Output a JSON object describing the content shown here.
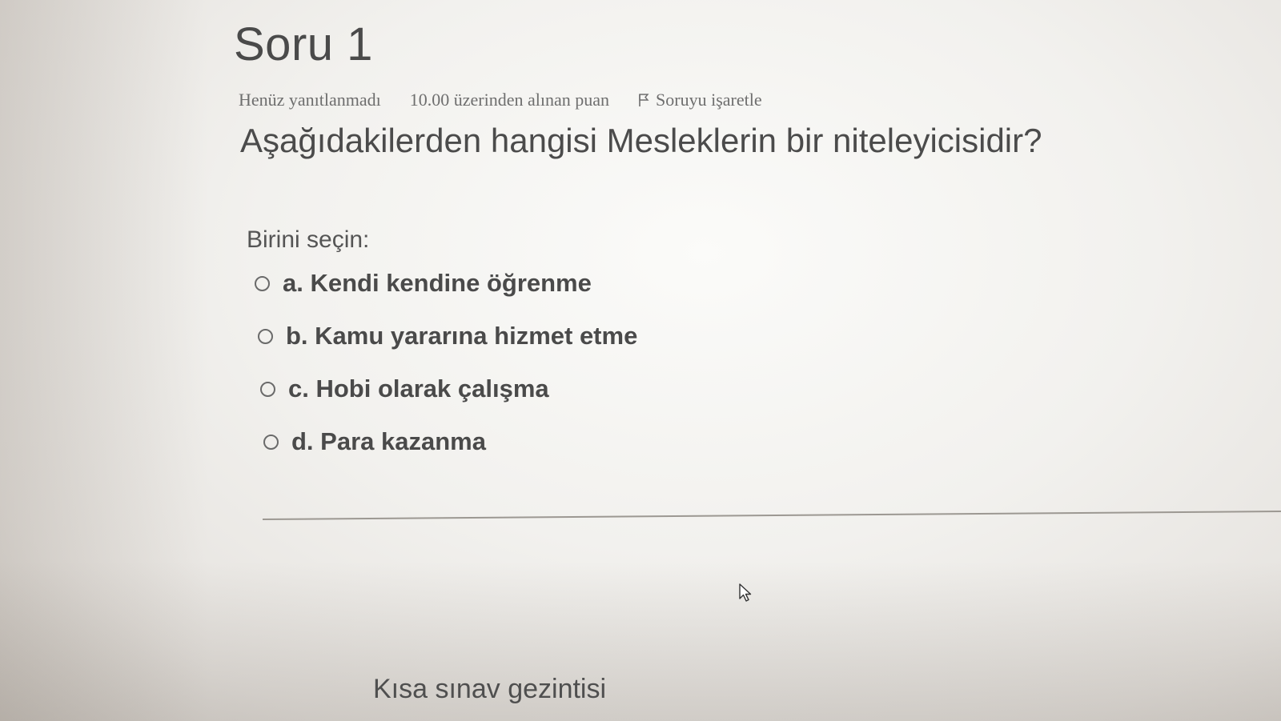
{
  "question": {
    "title": "Soru 1",
    "status": "Henüz yanıtlanmadı",
    "grade_info": "10.00 üzerinden alınan puan",
    "flag_label": "Soruyu işaretle",
    "flag_icon": "flag-icon",
    "text": "Aşağıdakilerden hangisi Mesleklerin bir niteleyicisidir?",
    "prompt": "Birini seçin:",
    "options": [
      {
        "label": "a. Kendi kendine öğrenme",
        "selected": false
      },
      {
        "label": "b. Kamu yararına hizmet etme",
        "selected": false
      },
      {
        "label": "c. Hobi olarak çalışma",
        "selected": false
      },
      {
        "label": "d. Para kazanma",
        "selected": false
      }
    ]
  },
  "navigation": {
    "quiz_nav_label": "Kısa sınav gezintisi"
  },
  "pointer": {
    "icon": "mouse-pointer-icon"
  }
}
